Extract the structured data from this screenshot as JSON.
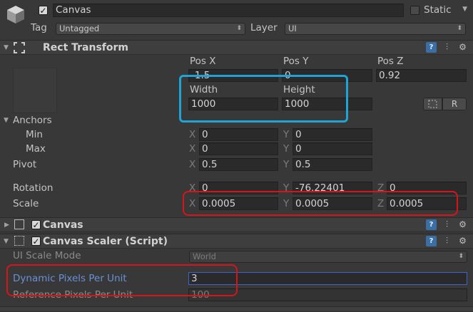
{
  "header": {
    "name": "Canvas",
    "static_label": "Static",
    "tag_label": "Tag",
    "tag_value": "Untagged",
    "layer_label": "Layer",
    "layer_value": "UI"
  },
  "rect_transform": {
    "title": "Rect Transform",
    "pos_x_label": "Pos X",
    "pos_y_label": "Pos Y",
    "pos_z_label": "Pos Z",
    "pos_x": "-1.5",
    "pos_y": "0",
    "pos_z": "0.92",
    "width_label": "Width",
    "height_label": "Height",
    "width": "1000",
    "height": "1000",
    "raw_button": "R",
    "anchors_label": "Anchors",
    "min_label": "Min",
    "min_x": "0",
    "min_y": "0",
    "max_label": "Max",
    "max_x": "0",
    "max_y": "0",
    "pivot_label": "Pivot",
    "pivot_x": "0.5",
    "pivot_y": "0.5",
    "rotation_label": "Rotation",
    "rot_x": "0",
    "rot_y": "-76.22401",
    "rot_z": "0",
    "scale_label": "Scale",
    "scale_x": "0.0005",
    "scale_y": "0.0005",
    "scale_z": "0.0005",
    "axis_x": "X",
    "axis_y": "Y",
    "axis_z": "Z"
  },
  "canvas_component": {
    "title": "Canvas"
  },
  "canvas_scaler": {
    "title": "Canvas Scaler (Script)",
    "ui_scale_mode_label": "UI Scale Mode",
    "ui_scale_mode_value": "World",
    "dynamic_pixels_label": "Dynamic Pixels Per Unit",
    "dynamic_pixels_value": "3",
    "reference_pixels_label": "Reference Pixels Per Unit",
    "reference_pixels_value": "100"
  },
  "colors": {
    "background": "#383838",
    "blue_highlight": "#1fa4d8",
    "red_highlight": "#d8141b",
    "selected_label": "#6b8fd6"
  }
}
